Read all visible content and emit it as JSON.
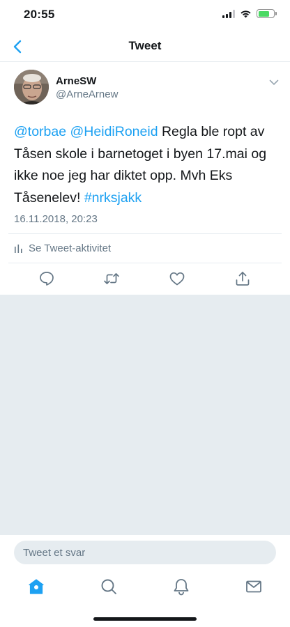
{
  "status": {
    "time": "20:55",
    "battery_level": 0.75,
    "battery_color": "#4cd964"
  },
  "nav": {
    "title": "Tweet",
    "back_icon": "chevron-left-icon"
  },
  "tweet": {
    "author_name": "ArneSW",
    "author_handle": "@ArneArnew",
    "text_segments": [
      {
        "text": "@torbae",
        "type": "mention"
      },
      {
        "text": " ",
        "type": "plain"
      },
      {
        "text": "@HeidiRoneid",
        "type": "mention"
      },
      {
        "text": " Regla ble ropt av Tåsen skole i barnetoget i byen 17.mai og ikke noe jeg har diktet opp. Mvh Eks Tåsenelev! ",
        "type": "plain"
      },
      {
        "text": "#nrksjakk",
        "type": "hashtag"
      }
    ],
    "timestamp": "16.11.2018, 20:23",
    "activity_label": "Se Tweet-aktivitet",
    "actions": [
      "reply-icon",
      "retweet-icon",
      "like-icon",
      "share-icon"
    ]
  },
  "reply": {
    "placeholder": "Tweet et svar"
  },
  "tabs": [
    "home-icon",
    "search-icon",
    "notifications-icon",
    "messages-icon"
  ],
  "colors": {
    "accent": "#1da1f2",
    "secondary_text": "#657786",
    "background_gray": "#e6ecf0"
  }
}
